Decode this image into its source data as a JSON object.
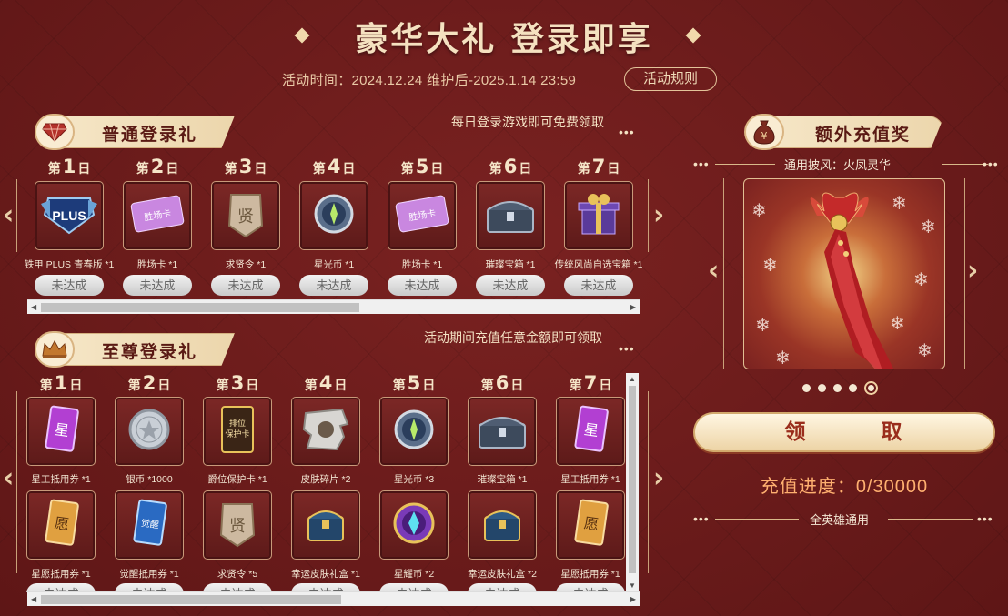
{
  "header": {
    "title": "豪华大礼  登录即享",
    "period": "活动时间：2024.12.24 维护后-2025.1.14 23:59",
    "rules_button": "活动规则"
  },
  "normal": {
    "title": "普通登录礼",
    "desc": "每日登录游戏即可免费领取",
    "dots": "•••",
    "days": [
      {
        "pre": "第",
        "num": "1",
        "suf": "日",
        "item": "铁甲 PLUS 青春版 *1",
        "status": "未达成",
        "icon": "plus-badge-icon"
      },
      {
        "pre": "第",
        "num": "2",
        "suf": "日",
        "item": "胜场卡 *1",
        "status": "未达成",
        "icon": "win-card-icon",
        "icon_text": "胜场卡"
      },
      {
        "pre": "第",
        "num": "3",
        "suf": "日",
        "item": "求贤令 *1",
        "status": "未达成",
        "icon": "talent-token-icon",
        "icon_text": "贤"
      },
      {
        "pre": "第",
        "num": "4",
        "suf": "日",
        "item": "星光币 *1",
        "status": "未达成",
        "icon": "star-coin-icon"
      },
      {
        "pre": "第",
        "num": "5",
        "suf": "日",
        "item": "胜场卡 *1",
        "status": "未达成",
        "icon": "win-card-icon",
        "icon_text": "胜场卡"
      },
      {
        "pre": "第",
        "num": "6",
        "suf": "日",
        "item": "璀璨宝箱 *1",
        "status": "未达成",
        "icon": "treasure-chest-icon"
      },
      {
        "pre": "第",
        "num": "7",
        "suf": "日",
        "item": "传统风尚自选宝箱 *1",
        "status": "未达成",
        "icon": "gift-box-icon"
      }
    ]
  },
  "supreme": {
    "title": "至尊登录礼",
    "desc": "活动期间充值任意金额即可领取",
    "dots": "•••",
    "days": [
      {
        "pre": "第",
        "num": "1",
        "suf": "日"
      },
      {
        "pre": "第",
        "num": "2",
        "suf": "日"
      },
      {
        "pre": "第",
        "num": "3",
        "suf": "日"
      },
      {
        "pre": "第",
        "num": "4",
        "suf": "日"
      },
      {
        "pre": "第",
        "num": "5",
        "suf": "日"
      },
      {
        "pre": "第",
        "num": "6",
        "suf": "日"
      },
      {
        "pre": "第",
        "num": "7",
        "suf": "日"
      }
    ],
    "row1": [
      {
        "item": "星工抵用券 *1",
        "icon": "star-voucher-icon",
        "icon_text": "星"
      },
      {
        "item": "银币 *1000",
        "icon": "silver-coin-icon"
      },
      {
        "item": "爵位保护卡 *1",
        "icon": "rank-protect-card-icon",
        "icon_text": "排位保护卡"
      },
      {
        "item": "皮肤碎片 *2",
        "icon": "skin-fragment-icon"
      },
      {
        "item": "星光币 *3",
        "icon": "star-coin-icon"
      },
      {
        "item": "璀璨宝箱 *1",
        "icon": "treasure-chest-icon"
      },
      {
        "item": "星工抵用券 *1",
        "icon": "star-voucher-icon",
        "icon_text": "星"
      }
    ],
    "row2": [
      {
        "item": "星愿抵用券 *1",
        "icon": "wish-voucher-icon",
        "icon_text": "愿"
      },
      {
        "item": "觉醒抵用券 *1",
        "icon": "awaken-voucher-icon",
        "icon_text": "觉醒"
      },
      {
        "item": "求贤令 *5",
        "icon": "talent-token-icon",
        "icon_text": "贤"
      },
      {
        "item": "幸运皮肤礼盒 *1",
        "icon": "lucky-skin-box-icon"
      },
      {
        "item": "星耀币 *2",
        "icon": "glory-coin-icon"
      },
      {
        "item": "幸运皮肤礼盒 *2",
        "icon": "lucky-skin-box-icon"
      },
      {
        "item": "星愿抵用券 *1",
        "icon": "wish-voucher-icon",
        "icon_text": "愿"
      }
    ]
  },
  "bonus": {
    "title": "额外充值奖",
    "badge": "¥",
    "prize_name": "通用披风：火凤灵华",
    "claim": "领　取",
    "progress": "充值进度：0/30000",
    "footer": "全英雄通用",
    "slides": 5,
    "active_slide": 5
  },
  "colors": {
    "bg": "#6b1b1a",
    "gold": "#f3e2c4",
    "accent": "#ffb070"
  }
}
